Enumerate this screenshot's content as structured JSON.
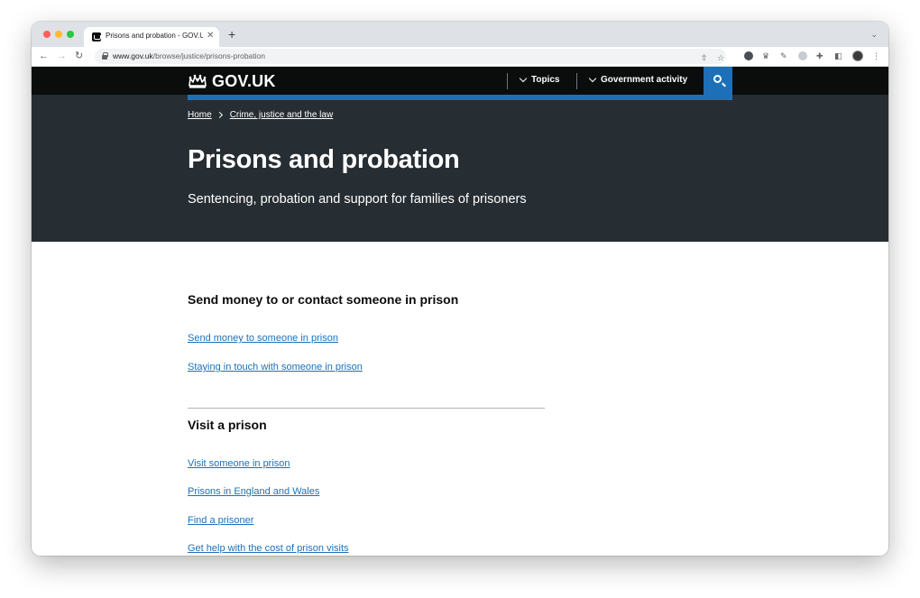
{
  "browser": {
    "tab_title": "Prisons and probation - GOV.UK",
    "new_tab_label": "+",
    "url_host": "www.gov.uk",
    "url_path": "/browse/justice/prisons-probation"
  },
  "header": {
    "logo_text": "GOV.UK",
    "menu": [
      {
        "label": "Topics"
      },
      {
        "label": "Government activity"
      }
    ]
  },
  "breadcrumbs": [
    {
      "label": "Home"
    },
    {
      "label": "Crime, justice and the law"
    }
  ],
  "hero": {
    "title": "Prisons and probation",
    "subtitle": "Sentencing, probation and support for families of prisoners"
  },
  "sections": [
    {
      "heading": "Send money to or contact someone in prison",
      "links": [
        "Send money to someone in prison",
        "Staying in touch with someone in prison"
      ]
    },
    {
      "heading": "Visit a prison",
      "links": [
        "Visit someone in prison",
        "Prisons in England and Wales",
        "Find a prisoner",
        "Get help with the cost of prison visits"
      ]
    }
  ],
  "colors": {
    "header_bg": "#0b0c0c",
    "hero_bg": "#272e33",
    "accent_blue": "#1d70b8",
    "link": "#1d70b8"
  }
}
